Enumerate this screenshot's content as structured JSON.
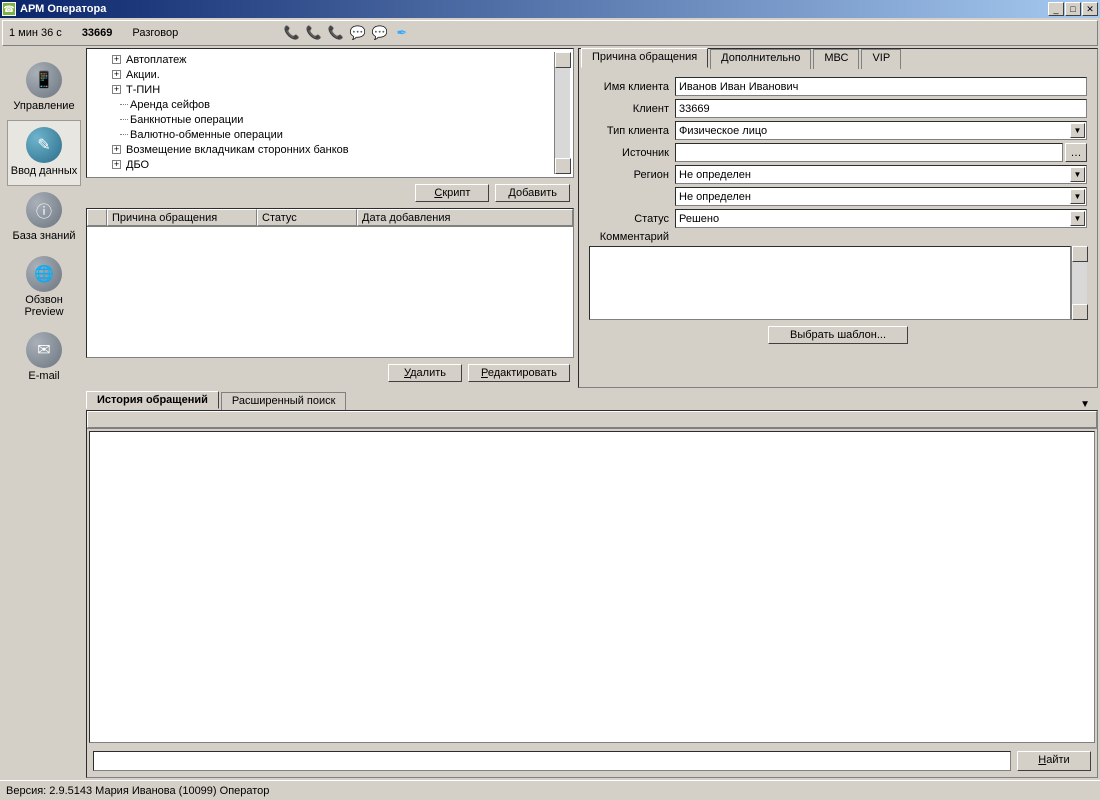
{
  "window": {
    "title": "АРМ Оператора"
  },
  "infobar": {
    "timer": "1 мин 36 с",
    "call_id": "33669",
    "status": "Разговор"
  },
  "sidebar": {
    "items": [
      {
        "label": "Управление",
        "glyph": "📱"
      },
      {
        "label": "Ввод данных",
        "glyph": "✎"
      },
      {
        "label": "База знаний",
        "glyph": "ⓘ"
      },
      {
        "label": "Обзвон Preview",
        "glyph": "🌐"
      },
      {
        "label": "E-mail",
        "glyph": "✉"
      }
    ]
  },
  "tree": {
    "nodes": [
      {
        "label": "Автоплатеж",
        "expandable": true
      },
      {
        "label": "Акции.",
        "expandable": true
      },
      {
        "label": "Т-ПИН",
        "expandable": true
      },
      {
        "label": "Аренда сейфов",
        "expandable": false
      },
      {
        "label": "Банкнотные операции",
        "expandable": false
      },
      {
        "label": "Валютно-обменные операции",
        "expandable": false
      },
      {
        "label": "Возмещение вкладчикам сторонних банков",
        "expandable": true
      },
      {
        "label": "ДБО",
        "expandable": true
      }
    ]
  },
  "buttons": {
    "script": "Скрипт",
    "add": "Добавить",
    "delete": "Удалить",
    "edit": "Редактировать",
    "template": "Выбрать шаблон...",
    "find": "Найти"
  },
  "reasons_table": {
    "columns": {
      "reason": "Причина обращения",
      "status": "Статус",
      "date": "Дата добавления"
    }
  },
  "right_tabs": {
    "t1": "Причина обращения",
    "t2": "Дополнительно",
    "t3": "МВС",
    "t4": "VIP"
  },
  "form": {
    "labels": {
      "name": "Имя клиента",
      "client": "Клиент",
      "type": "Тип клиента",
      "source": "Источник",
      "region": "Регион",
      "status": "Статус",
      "comment": "Комментарий"
    },
    "values": {
      "name": "Иванов Иван Иванович",
      "client": "33669",
      "type": "Физическое лицо",
      "source": "",
      "region": "Не определен",
      "region2": "Не определен",
      "status": "Решено"
    }
  },
  "history_tabs": {
    "t1": "История обращений",
    "t2": "Расширенный поиск"
  },
  "statusbar": {
    "text": "Версия: 2.9.5143  Мария Иванова (10099) Оператор"
  }
}
